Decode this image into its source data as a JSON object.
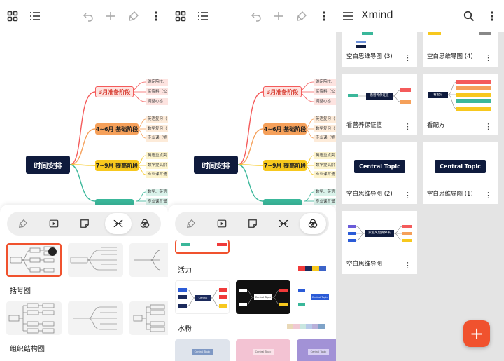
{
  "panel1": {
    "mindmap": {
      "root": "时间安排",
      "branches": [
        {
          "label": "3月准备阶段",
          "color": "#f45b5b",
          "leaves": [
            "确定院校、",
            "买资料（公",
            "调整心态、"
          ]
        },
        {
          "label": "4~6月 基础阶段",
          "color": "#f5a05a",
          "leaves": [
            "英语复习（",
            "数学复习（",
            "专业课（整"
          ]
        },
        {
          "label": "7~9月 提高阶段",
          "color": "#f7c81e",
          "leaves": [
            "英语重点突",
            "数学提高阶",
            "专业课背诵"
          ]
        },
        {
          "label": "",
          "color": "#3ab79a",
          "leaves": [
            "数学、英语",
            "专业课背诵"
          ]
        }
      ]
    },
    "sections": [
      {
        "label": "括号图"
      },
      {
        "label": "组织结构图"
      }
    ]
  },
  "panel2": {
    "mindmap": {
      "root": "时间安排",
      "branches": [
        {
          "label": "3月准备阶段",
          "leaves": [
            "确定院校、",
            "买资料（公",
            "调整心态、"
          ]
        },
        {
          "label": "4~6月 基础阶段",
          "leaves": [
            "英语复习（",
            "数学复习（",
            "专业课（整"
          ]
        },
        {
          "label": "7~9月 提高阶段",
          "leaves": [
            "英语重点突",
            "数学提高阶",
            "专业课背诵"
          ]
        },
        {
          "label": "",
          "leaves": [
            "数学、英语",
            "专业课背诵"
          ]
        }
      ]
    },
    "themes": [
      {
        "label": "活力",
        "swatches": [
          "#f03a3a",
          "#1b2a5c",
          "#f7c81e",
          "#3c63c8"
        ]
      },
      {
        "label": "水粉",
        "swatches": [
          "#e9d9b8",
          "#f0c9d4",
          "#c8e6e0",
          "#b7c9e9",
          "#b9b0d9",
          "#7fa3c8"
        ]
      }
    ],
    "theme_card_text": "Central Topic"
  },
  "panel3": {
    "app_title": "Xmind",
    "cards": [
      {
        "title": "空白思维导图 (3)"
      },
      {
        "title": "空白思维导图 (4)"
      },
      {
        "title": "看营养保证值",
        "center": "看营养保证值"
      },
      {
        "title": "看配方",
        "center": "看配方"
      },
      {
        "title": "空白思维导图 (2)",
        "center": "Central Topic"
      },
      {
        "title": "空白思维导图 (1)",
        "center": "Central Topic"
      },
      {
        "title": "空白思维导图",
        "center": "家庭风险保障表"
      }
    ],
    "more_glyph": "⋮",
    "fab_label": "+"
  },
  "colors": {
    "accent": "#f0522e",
    "root_node": "#0f1b3d",
    "selected_border": "#f0522e"
  },
  "icons": [
    "grid-icon",
    "list-icon",
    "undo-icon",
    "add-icon",
    "format-brush-icon",
    "more-vertical-icon",
    "menu-icon",
    "search-icon",
    "play-icon",
    "sticky-note-icon",
    "structure-icon",
    "theme-icon"
  ]
}
